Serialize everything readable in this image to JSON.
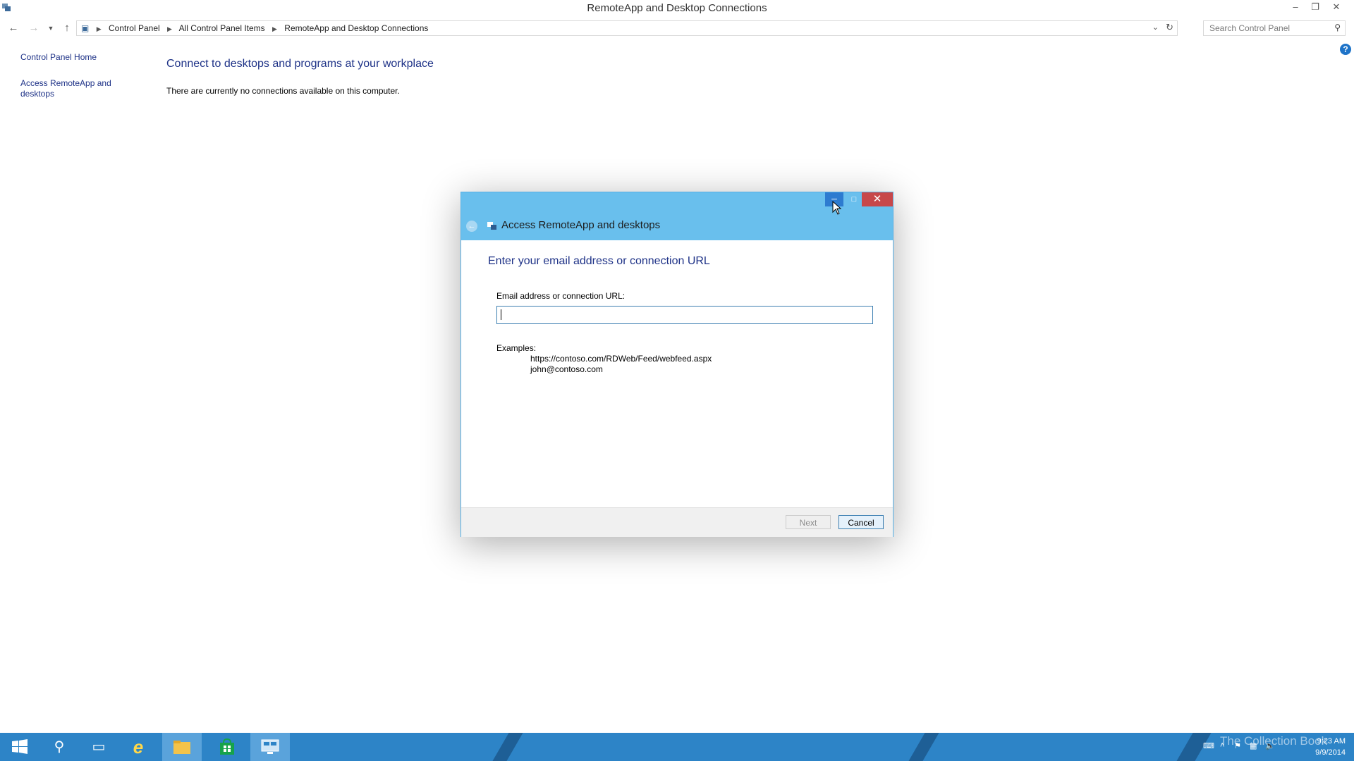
{
  "window": {
    "title": "RemoteApp and Desktop Connections"
  },
  "address_bar": {
    "crumbs": [
      "Control Panel",
      "All Control Panel Items",
      "RemoteApp and Desktop Connections"
    ],
    "search_placeholder": "Search Control Panel"
  },
  "left_pane": {
    "home_link": "Control Panel Home",
    "access_link": "Access RemoteApp and desktops"
  },
  "main": {
    "heading": "Connect to desktops and programs at your workplace",
    "status": "There are currently no connections available on this computer."
  },
  "dialog": {
    "title": "Access RemoteApp and desktops",
    "heading": "Enter your email address or connection URL",
    "field_label": "Email address or connection URL:",
    "field_value": "",
    "examples_label": "Examples:",
    "examples": [
      "https://contoso.com/RDWeb/Feed/webfeed.aspx",
      "john@contoso.com"
    ],
    "next_label": "Next",
    "cancel_label": "Cancel",
    "next_enabled": false
  },
  "taskbar": {
    "time": "9:23 AM",
    "date": "9/9/2014",
    "watermark": "The Collection Book",
    "accent_color": "#2d84c7"
  },
  "icons": [
    "start-icon",
    "search-icon",
    "task-view-icon",
    "internet-explorer-icon",
    "file-explorer-icon",
    "store-icon",
    "remote-desktop-icon"
  ]
}
